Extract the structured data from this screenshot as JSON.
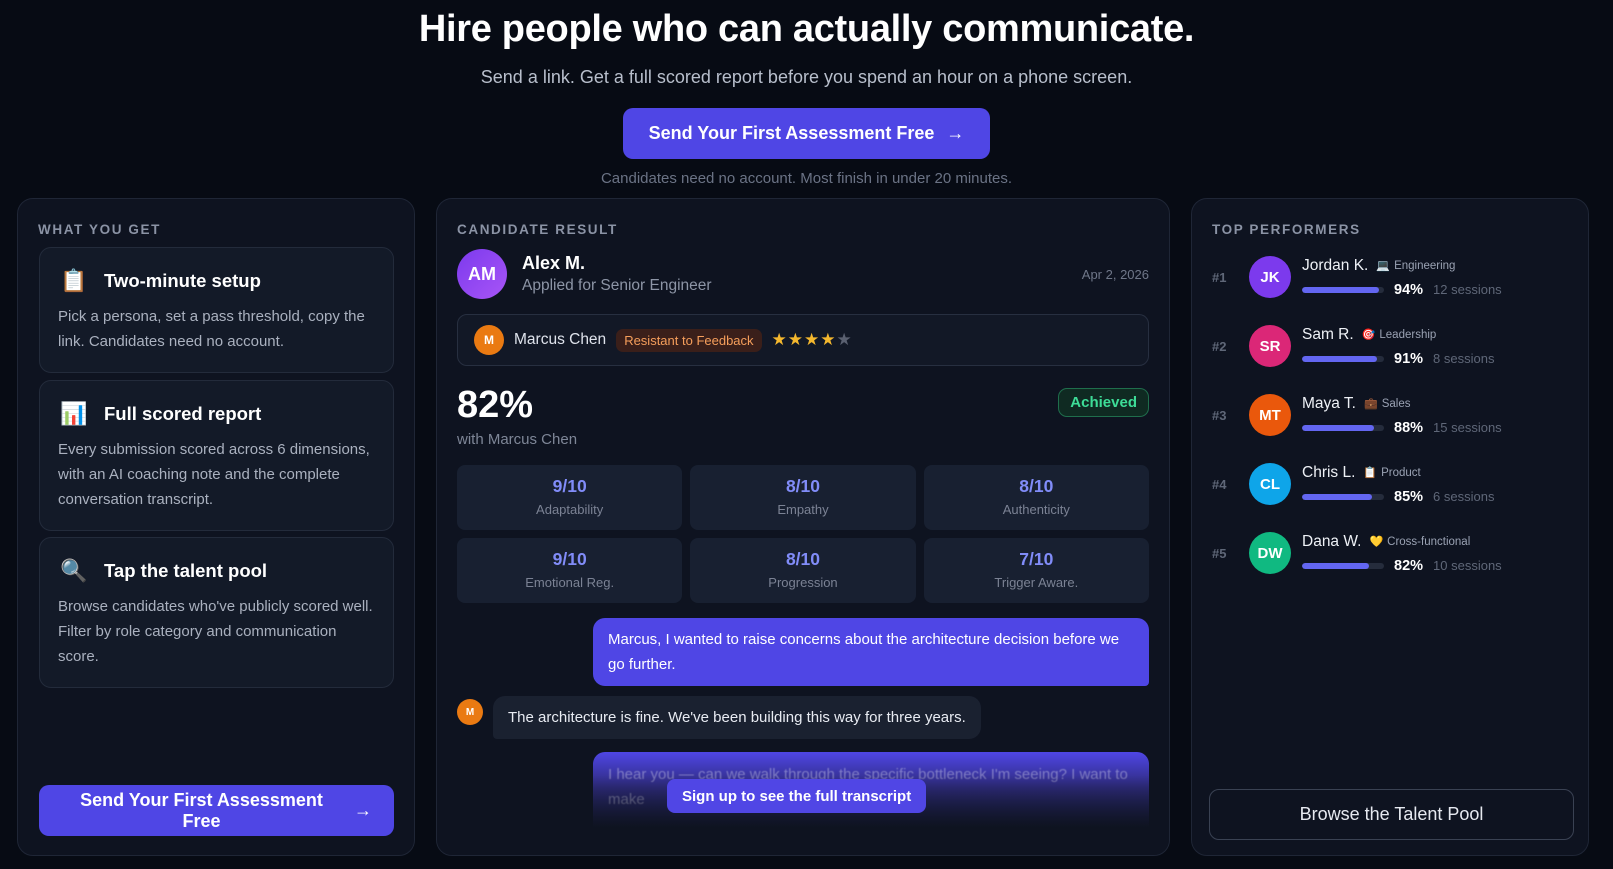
{
  "hero": {
    "title": "Hire people who can actually communicate.",
    "subtitle": "Send a link. Get a full scored report before you spend an hour on a phone screen.",
    "cta_label": "Send Your First Assessment Free",
    "note": "Candidates need no account. Most finish in under 20 minutes."
  },
  "left": {
    "title": "WHAT YOU GET",
    "features": [
      {
        "icon": "clipboard-icon",
        "title": "Two-minute setup",
        "desc": "Pick a persona, set a pass threshold, copy the link. Candidates need no account."
      },
      {
        "icon": "bar-chart-icon",
        "title": "Full scored report",
        "desc": "Every submission scored across 6 dimensions, with an AI coaching note and the complete conversation transcript."
      },
      {
        "icon": "magnifier-icon",
        "title": "Tap the talent pool",
        "desc": "Browse candidates who've publicly scored well. Filter by role category and communication score."
      }
    ],
    "cta_label": "Send Your First Assessment Free"
  },
  "middle": {
    "title": "CANDIDATE RESULT",
    "candidate": {
      "initials": "AM",
      "name": "Alex M.",
      "role": "Applied for Senior Engineer",
      "date": "Apr 2, 2026"
    },
    "persona": {
      "initial": "M",
      "name": "Marcus Chen",
      "tag": "Resistant to Feedback",
      "stars": 4,
      "stars_max": 5
    },
    "score": "82%",
    "score_sub": "with Marcus Chen",
    "badge": "Achieved",
    "dimensions": [
      {
        "value": "9/10",
        "label": "Adaptability"
      },
      {
        "value": "8/10",
        "label": "Empathy"
      },
      {
        "value": "8/10",
        "label": "Authenticity"
      },
      {
        "value": "9/10",
        "label": "Emotional Reg."
      },
      {
        "value": "8/10",
        "label": "Progression"
      },
      {
        "value": "7/10",
        "label": "Trigger Aware."
      }
    ],
    "messages": {
      "out1": "Marcus, I wanted to raise concerns about the architecture decision before we go further.",
      "in1_initial": "M",
      "in1": "The architecture is fine. We've been building this way for three years.",
      "out2": "I hear you — can we walk through the specific bottleneck I'm seeing? I want to make"
    },
    "signup_label": "Sign up to see the full transcript"
  },
  "right": {
    "title": "TOP PERFORMERS",
    "performers": [
      {
        "rank": "#1",
        "initials": "JK",
        "name": "Jordan K.",
        "cat_icon": "computer-icon",
        "cat_glyph": "💻",
        "category": "Engineering",
        "pct": "94%",
        "fill": 0.94,
        "sessions": "12 sessions",
        "color": "#7c3aed"
      },
      {
        "rank": "#2",
        "initials": "SR",
        "name": "Sam R.",
        "cat_icon": "target-icon",
        "cat_glyph": "🎯",
        "category": "Leadership",
        "pct": "91%",
        "fill": 0.91,
        "sessions": "8 sessions",
        "color": "#db2777"
      },
      {
        "rank": "#3",
        "initials": "MT",
        "name": "Maya T.",
        "cat_icon": "briefcase-icon",
        "cat_glyph": "💼",
        "category": "Sales",
        "pct": "88%",
        "fill": 0.88,
        "sessions": "15 sessions",
        "color": "#ea580c"
      },
      {
        "rank": "#4",
        "initials": "CL",
        "name": "Chris L.",
        "cat_icon": "clipboard-icon",
        "cat_glyph": "📋",
        "category": "Product",
        "pct": "85%",
        "fill": 0.85,
        "sessions": "6 sessions",
        "color": "#0ea5e9"
      },
      {
        "rank": "#5",
        "initials": "DW",
        "name": "Dana W.",
        "cat_icon": "heart-icon",
        "cat_glyph": "💛",
        "category": "Cross-functional",
        "pct": "82%",
        "fill": 0.82,
        "sessions": "10 sessions",
        "color": "#10b981"
      }
    ],
    "browse_label": "Browse the Talent Pool"
  }
}
